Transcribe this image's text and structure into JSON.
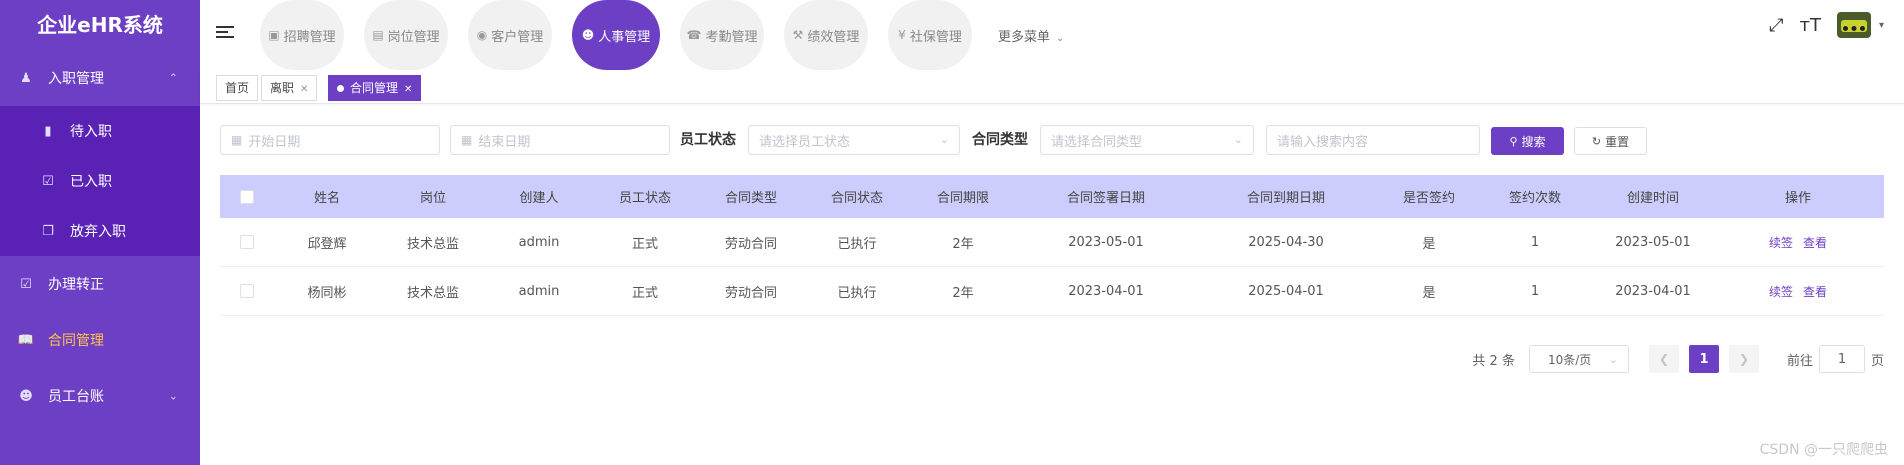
{
  "sidebar": {
    "brand": "企业eHR系统",
    "onboarding": {
      "label": "入职管理",
      "icon": "user-icon"
    },
    "sub": [
      {
        "label": "待入职",
        "icon": "book-icon"
      },
      {
        "label": "已入职",
        "icon": "check-square-icon"
      },
      {
        "label": "放弃入职",
        "icon": "copy-icon"
      }
    ],
    "items": [
      {
        "label": "办理转正",
        "icon": "check-square-icon"
      },
      {
        "label": "合同管理",
        "icon": "open-book-icon"
      },
      {
        "label": "员工台账",
        "icon": "person-icon"
      }
    ]
  },
  "topbar": {
    "modules": [
      {
        "label": "招聘管理",
        "icon": "picture-icon"
      },
      {
        "label": "岗位管理",
        "icon": "document-icon"
      },
      {
        "label": "客户管理",
        "icon": "globe-icon"
      },
      {
        "label": "人事管理",
        "icon": "person-icon"
      },
      {
        "label": "考勤管理",
        "icon": "attendance-icon"
      },
      {
        "label": "绩效管理",
        "icon": "performance-icon"
      },
      {
        "label": "社保管理",
        "icon": "yen-icon"
      }
    ],
    "more_label": "更多菜单"
  },
  "tags": [
    {
      "label": "首页"
    },
    {
      "label": "离职"
    },
    {
      "label": "合同管理"
    }
  ],
  "filters": {
    "start_date_placeholder": "开始日期",
    "end_date_placeholder": "结束日期",
    "status_label": "员工状态",
    "status_placeholder": "请选择员工状态",
    "contract_type_label": "合同类型",
    "contract_type_placeholder": "请选择合同类型",
    "search_placeholder": "请输入搜索内容",
    "search_button": "搜索",
    "reset_button": "重置"
  },
  "table": {
    "columns": [
      "姓名",
      "岗位",
      "创建人",
      "员工状态",
      "合同类型",
      "合同状态",
      "合同期限",
      "合同签署日期",
      "合同到期日期",
      "是否签约",
      "签约次数",
      "创建时间",
      "操作"
    ],
    "rows": [
      {
        "name": "邱登辉",
        "position": "技术总监",
        "creator": "admin",
        "emp_status": "正式",
        "contract_type": "劳动合同",
        "contract_status": "已执行",
        "term": "2年",
        "sign_date": "2023-05-01",
        "expire_date": "2025-04-30",
        "signed": "是",
        "sign_count": "1",
        "created": "2023-05-01",
        "op_renew": "续签",
        "op_view": "查看"
      },
      {
        "name": "杨同彬",
        "position": "技术总监",
        "creator": "admin",
        "emp_status": "正式",
        "contract_type": "劳动合同",
        "contract_status": "已执行",
        "term": "2年",
        "sign_date": "2023-04-01",
        "expire_date": "2025-04-01",
        "signed": "是",
        "sign_count": "1",
        "created": "2023-04-01",
        "op_renew": "续签",
        "op_view": "查看"
      }
    ]
  },
  "pager": {
    "total_text": "共 2 条",
    "page_size": "10条/页",
    "current_page": "1",
    "goto_label": "前往",
    "goto_value": "1",
    "page_unit": "页"
  },
  "watermark": "CSDN @一只爬爬虫",
  "colors": {
    "primary": "#6d3fc4",
    "header_bg": "#cdcdfd",
    "active_menu": "#ffc44d"
  }
}
